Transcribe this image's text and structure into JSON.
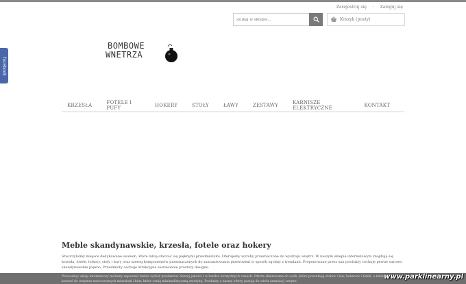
{
  "header": {
    "register_label": "Zarejestruj się",
    "login_label": "Zaloguj się",
    "search_placeholder": "szukaj w sklepie...",
    "cart_label": "Koszyk (pusty)"
  },
  "logo": {
    "line1": "BOMBOWE",
    "line2": "WNETRZA"
  },
  "nav": {
    "items": [
      "KRZESŁA",
      "FOTELE I PUFY",
      "HOKERY",
      "STOŁY",
      "ŁAWY",
      "ZESTAWY",
      "KARNISZE ELEKTRYCZNE",
      "KONTAKT"
    ]
  },
  "social": {
    "facebook_label": "facebook"
  },
  "main": {
    "title": "Meble skandynawskie, krzesła, fotele oraz hokery",
    "intro": "Stworzyliśmy miejsce dedykowane osobom, które lubią otaczać się pięknymi przedmiotami. Oferujemy wyroby przeznaczone do wystroju wnętrz. W naszym sklepie internetowym znajdują się krzesła, fotele, hokery, stoły i ławy oraz szereg komponentów przeznaczonych do zaaranżowania przestrzeni w sposób zgodny z trendami. Proponowane przez nas produkty cechuje pewne surowe, skandynawskie piękno. Przedmioty cechuje atrakcyjne zestawienie prostoty designu.",
    "footer_line1": "Prowadząc sklep internetowy możemy zapewnić meble wybór produktów dobrej jakości i w bardzo korzystnych cenach. Oferta skierowana do osób, które poszukują stołów i ław, hokerów i foteli, a także",
    "footer_line2": "krzeseł do wnętrza nowoczesnych mieszkań i biur, które cenią minimalistyczną estetykę. Produkty z naszej oferty pasują do wielu aranżacji wnętrz."
  },
  "watermark": {
    "text": "www.parklinearny.pl"
  }
}
